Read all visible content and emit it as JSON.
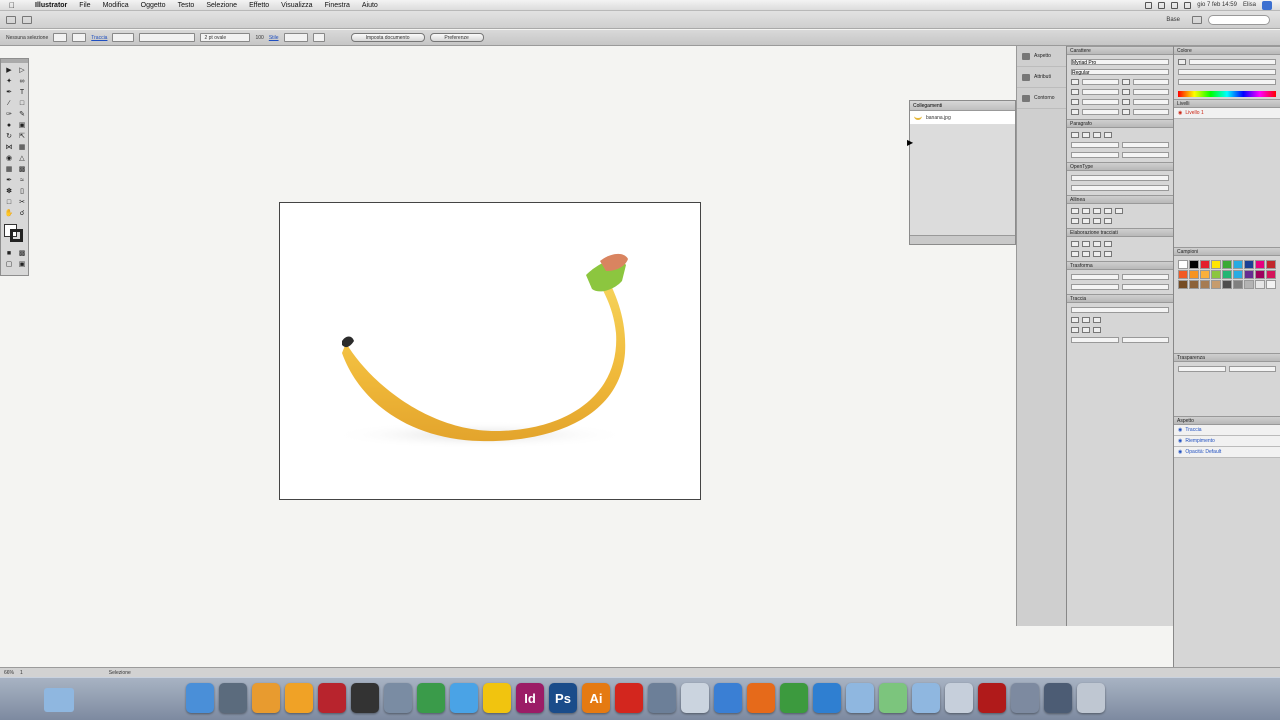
{
  "menubar": {
    "app": "Illustrator",
    "items": [
      "File",
      "Modifica",
      "Oggetto",
      "Testo",
      "Selezione",
      "Effetto",
      "Visualizza",
      "Finestra",
      "Aiuto"
    ],
    "clock": "gio 7 feb 14:59",
    "right_label": "Elisa"
  },
  "appbar": {
    "workspace": "Base"
  },
  "controlbar": {
    "selection_label": "Nessuna selezione",
    "stroke_label": "Traccia",
    "stroke_value": "",
    "brush_value": "",
    "style_label": "2 pt ovale",
    "opacity_label": "Stile",
    "opacity_value": "100",
    "doc_setup_button": "Imposta documento",
    "preferences_button": "Preferenze"
  },
  "links_panel": {
    "title": "Collegamenti",
    "item": "banana.jpg"
  },
  "dock_strip": {
    "items": [
      "Aspetto",
      "Attributi",
      "Contorno"
    ]
  },
  "panels_right": {
    "character": "Carattere",
    "font": "Myriad Pro",
    "font_style": "Regular",
    "paragraph": "Paragrafo",
    "opentype": "OpenType",
    "align": "Allinea",
    "pathfinder": "Elaborazione tracciati",
    "transform": "Trasforma",
    "stroke": "Traccia",
    "color": "Colore",
    "layers": "Livelli",
    "layer_name": "Livello 1",
    "swatches": "Campioni",
    "transparency": "Trasparenza",
    "appearance": "Aspetto",
    "appearance_items": [
      "Traccia",
      "Riempimento",
      "Opacità: Default"
    ]
  },
  "statusbar": {
    "zoom": "66%",
    "page": "1",
    "tool": "Selezione"
  },
  "dock": {
    "apps": [
      {
        "name": "finder",
        "label": "",
        "color": "#4a8fd8"
      },
      {
        "name": "system-prefs",
        "label": "",
        "color": "#5b6b7d"
      },
      {
        "name": "pages",
        "label": "",
        "color": "#e89b2f"
      },
      {
        "name": "ibooks",
        "label": "",
        "color": "#f0a226"
      },
      {
        "name": "photo-booth",
        "label": "",
        "color": "#b8242d"
      },
      {
        "name": "clock",
        "label": "",
        "color": "#333333"
      },
      {
        "name": "preview",
        "label": "",
        "color": "#7a8ca3"
      },
      {
        "name": "istat",
        "label": "",
        "color": "#3a9b4a"
      },
      {
        "name": "itunes",
        "label": "",
        "color": "#4aa3e6"
      },
      {
        "name": "pencil",
        "label": "",
        "color": "#f1c40f"
      },
      {
        "name": "indesign",
        "label": "Id",
        "color": "#9b1c66"
      },
      {
        "name": "photoshop",
        "label": "Ps",
        "color": "#1a4c8a"
      },
      {
        "name": "illustrator",
        "label": "Ai",
        "color": "#e57a12"
      },
      {
        "name": "acrobat",
        "label": "",
        "color": "#d3261e"
      },
      {
        "name": "photos",
        "label": "",
        "color": "#6c7f98"
      },
      {
        "name": "calendar",
        "label": "",
        "color": "#cbd4df"
      },
      {
        "name": "mail",
        "label": "",
        "color": "#3a7fd4"
      },
      {
        "name": "firefox",
        "label": "",
        "color": "#e66a1a"
      },
      {
        "name": "chrome",
        "label": "",
        "color": "#3c9a3e"
      },
      {
        "name": "safari",
        "label": "",
        "color": "#2f7fd1"
      },
      {
        "name": "folder-a",
        "label": "",
        "color": "#8fb7e0"
      },
      {
        "name": "folder-b",
        "label": "",
        "color": "#7cc57d"
      },
      {
        "name": "folder-c",
        "label": "",
        "color": "#8fb7e0"
      },
      {
        "name": "folder-d",
        "label": "",
        "color": "#c6cfdb"
      },
      {
        "name": "acrobat-reader",
        "label": "",
        "color": "#b01a1a"
      },
      {
        "name": "disk-utility",
        "label": "",
        "color": "#7d8aa0"
      },
      {
        "name": "network",
        "label": "",
        "color": "#4c5c74"
      },
      {
        "name": "trash",
        "label": "",
        "color": "#bfc7d2"
      }
    ]
  }
}
